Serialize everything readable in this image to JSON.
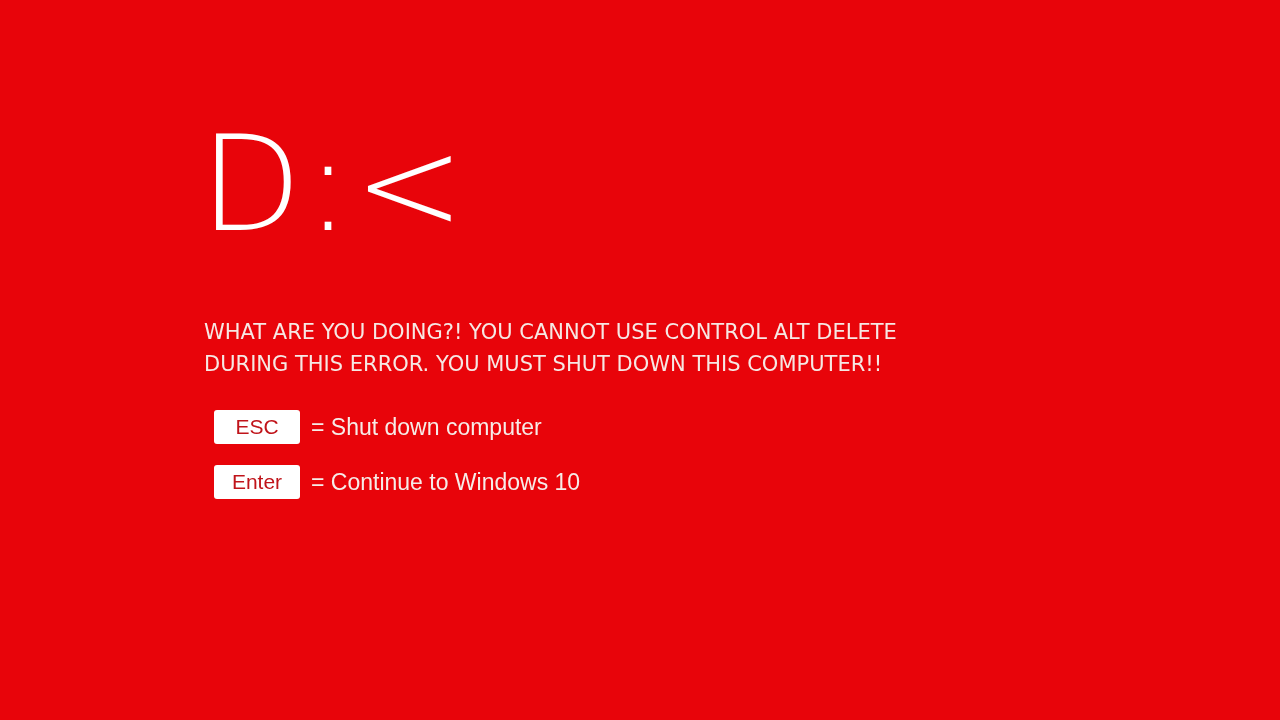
{
  "emoticon": "D:<",
  "message": "WHAT ARE YOU DOING?! YOU CANNOT USE CONTROL ALT DELETE DURING THIS ERROR. YOU MUST SHUT DOWN THIS COMPUTER!!",
  "options": [
    {
      "key": "ESC",
      "action": "= Shut down computer"
    },
    {
      "key": "Enter",
      "action": "= Continue to Windows 10"
    }
  ]
}
